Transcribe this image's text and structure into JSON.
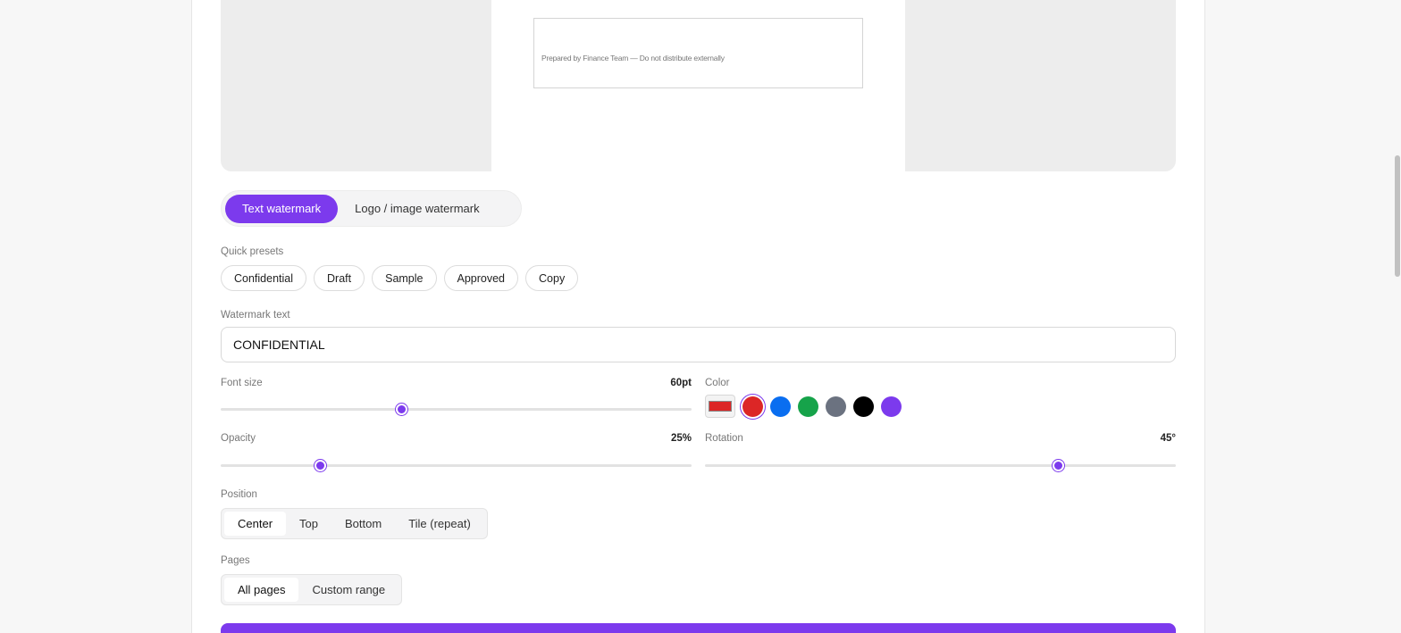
{
  "preview": {
    "footer_text": "Prepared by Finance Team — Do not distribute externally"
  },
  "tabs": [
    {
      "label": "Text watermark",
      "active": true
    },
    {
      "label": "Logo / image watermark",
      "active": false
    }
  ],
  "presets": {
    "label": "Quick presets",
    "items": [
      "Confidential",
      "Draft",
      "Sample",
      "Approved",
      "Copy"
    ]
  },
  "watermark_text": {
    "label": "Watermark text",
    "value": "CONFIDENTIAL"
  },
  "font_size": {
    "label": "Font size",
    "value_display": "60pt",
    "value": 60,
    "min": 8,
    "max": 144
  },
  "color": {
    "label": "Color",
    "picker_value": "#dc2626",
    "swatches": [
      "#dc2626",
      "#0a6ef0",
      "#16a34a",
      "#6b7280",
      "#000000",
      "#7c3aed"
    ],
    "selected": "#dc2626"
  },
  "opacity": {
    "label": "Opacity",
    "value_display": "25%",
    "value": 25,
    "min": 5,
    "max": 100
  },
  "rotation": {
    "label": "Rotation",
    "value_display": "45°",
    "value": 45,
    "min": -90,
    "max": 90
  },
  "position": {
    "label": "Position",
    "options": [
      "Center",
      "Top",
      "Bottom",
      "Tile (repeat)"
    ],
    "selected": "Center"
  },
  "pages": {
    "label": "Pages",
    "options": [
      "All pages",
      "Custom range"
    ],
    "selected": "All pages"
  },
  "scroll": {
    "fraction": 0.25
  }
}
